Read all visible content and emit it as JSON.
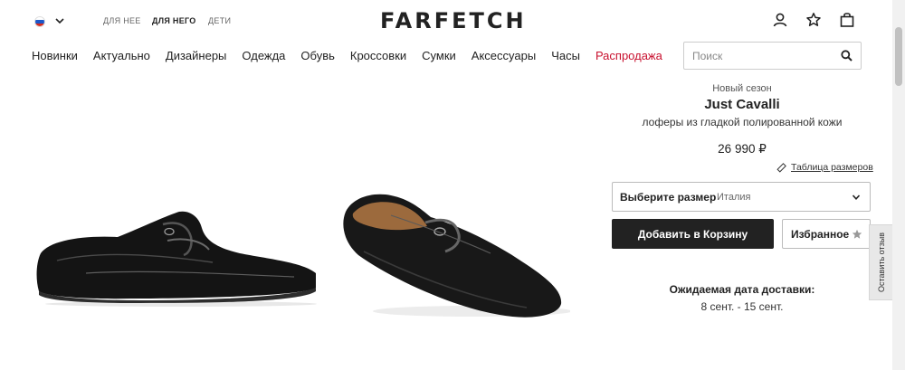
{
  "header": {
    "gender_tabs": [
      "ДЛЯ НЕЕ",
      "ДЛЯ НЕГО",
      "ДЕТИ"
    ],
    "active_tab": "ДЛЯ НЕГО",
    "logo": "FARFETCH",
    "icons": [
      "account-icon",
      "star-icon",
      "shopping-bag-icon"
    ]
  },
  "nav": {
    "items": [
      "Новинки",
      "Актуально",
      "Дизайнеры",
      "Одежда",
      "Обувь",
      "Кроссовки",
      "Сумки",
      "Аксессуары",
      "Часы"
    ],
    "sale_label": "Распродажа",
    "sale_color": "#c8102e"
  },
  "search": {
    "placeholder": "Поиск"
  },
  "product": {
    "season": "Новый сезон",
    "brand": "Just Cavalli",
    "description": "лоферы из гладкой полированной кожи",
    "price": "26 990 ₽"
  },
  "size_guide_label": "Таблица размеров",
  "size_select": {
    "label": "Выберите размер",
    "region": "Италия"
  },
  "buttons": {
    "add_to_bag": "Добавить в Корзину",
    "wishlist": "Избранное"
  },
  "delivery": {
    "title": "Ожидаемая дата доставки:",
    "dates": "8 сент. - 15 сент."
  },
  "feedback_tab": "Оставить отзыв"
}
